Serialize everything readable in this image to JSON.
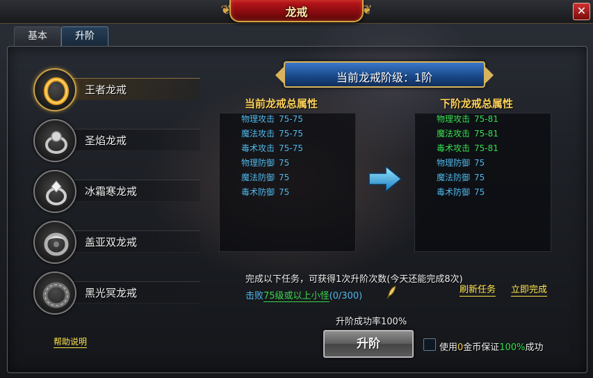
{
  "window": {
    "title": "龙戒",
    "close_label": "✕"
  },
  "tabs": [
    {
      "label": "基本",
      "active": false
    },
    {
      "label": "升阶",
      "active": true
    }
  ],
  "rings": [
    {
      "name": "王者龙戒",
      "icon": "gold-ring-icon",
      "active": true
    },
    {
      "name": "圣焰龙戒",
      "icon": "gem-ring-icon",
      "active": false
    },
    {
      "name": "冰霜寒龙戒",
      "icon": "diamond-ring-icon",
      "active": false
    },
    {
      "name": "盖亚双龙戒",
      "icon": "dragon-ring-icon",
      "active": false
    },
    {
      "name": "黑光冥龙戒",
      "icon": "dark-ring-icon",
      "active": false
    }
  ],
  "help_link": "帮助说明",
  "level_banner": "当前龙戒阶级：1阶",
  "current_panel": {
    "title": "当前龙戒总属性",
    "stats": [
      {
        "name": "物理攻击",
        "value": "75-75"
      },
      {
        "name": "魔法攻击",
        "value": "75-75"
      },
      {
        "name": "毒术攻击",
        "value": "75-75"
      },
      {
        "name": "物理防御",
        "value": "75"
      },
      {
        "name": "魔法防御",
        "value": "75"
      },
      {
        "name": "毒术防御",
        "value": "75"
      }
    ]
  },
  "next_panel": {
    "title": "下阶龙戒总属性",
    "stats": [
      {
        "name": "物理攻击",
        "value": "75-81",
        "improved": true
      },
      {
        "name": "魔法攻击",
        "value": "75-81",
        "improved": true
      },
      {
        "name": "毒术攻击",
        "value": "75-81",
        "improved": true
      },
      {
        "name": "物理防御",
        "value": "75",
        "improved": false
      },
      {
        "name": "魔法防御",
        "value": "75",
        "improved": false
      },
      {
        "name": "毒术防御",
        "value": "75",
        "improved": false
      }
    ]
  },
  "task": {
    "description": "完成以下任务，可获得1次升阶次数(今天还能完成8次)",
    "prefix": "击败",
    "target": "75级或以上小怪",
    "progress": "(0/300)",
    "refresh_label": "刷新任务",
    "finish_label": "立即完成"
  },
  "success_rate": "升阶成功率100%",
  "upgrade_button": "升阶",
  "guarantee": {
    "checked": false,
    "prefix": "使用",
    "gold_amount": "0",
    "middle": "金币保证",
    "percent": "100%",
    "suffix": "成功"
  },
  "colors": {
    "stat_current": "#4fb8ea",
    "stat_improved": "#36e050",
    "link_yellow": "#ffe34a",
    "title_red": "#c2161d",
    "banner_blue": "#1a4a8c"
  }
}
